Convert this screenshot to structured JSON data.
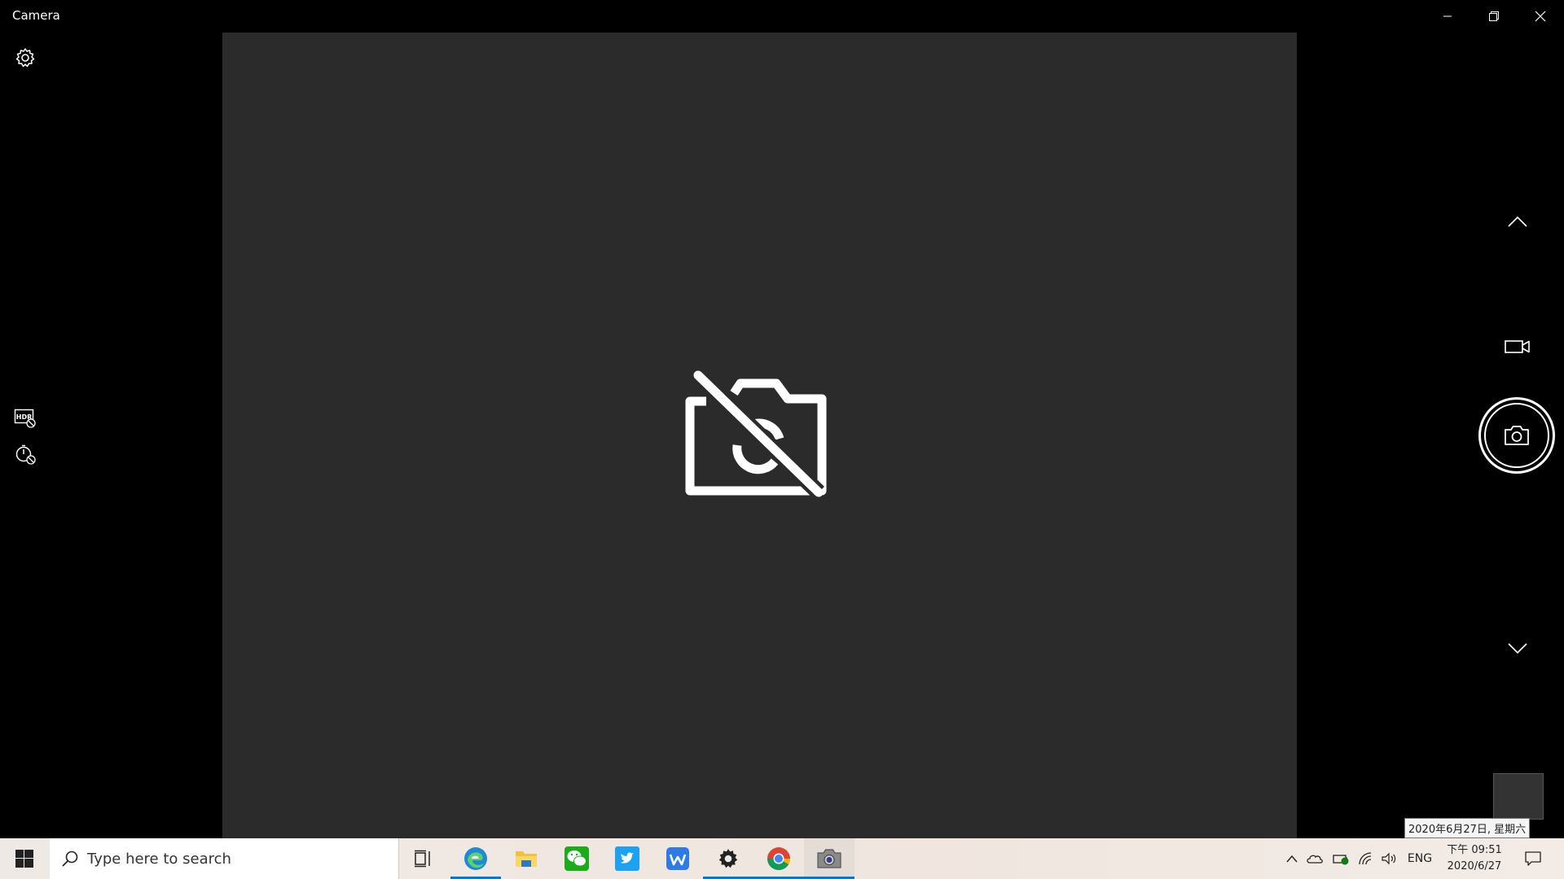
{
  "window": {
    "title": "Camera"
  },
  "taskbar": {
    "search_placeholder": "Type here to search",
    "language": "ENG",
    "clock_time": "下午 09:51",
    "clock_date": "2020/6/27",
    "date_tooltip": "2020年6月27日, 星期六",
    "apps": [
      "task-view",
      "edge",
      "file-explorer",
      "wechat",
      "twitter",
      "wps",
      "settings",
      "chrome",
      "camera"
    ]
  },
  "colors": {
    "preview_bg": "#2b2b2b",
    "accent": "#0078d7"
  }
}
